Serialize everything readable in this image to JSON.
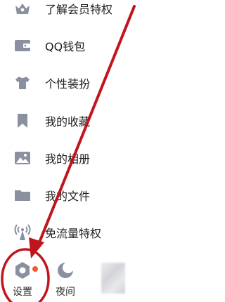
{
  "menu": {
    "items": [
      {
        "label": "了解会员特权",
        "icon": "crown-icon"
      },
      {
        "label": "QQ钱包",
        "icon": "wallet-icon"
      },
      {
        "label": "个性装扮",
        "icon": "tshirt-icon"
      },
      {
        "label": "我的收藏",
        "icon": "bookmark-icon"
      },
      {
        "label": "我的相册",
        "icon": "photo-icon"
      },
      {
        "label": "我的文件",
        "icon": "folder-icon"
      },
      {
        "label": "免流量特权",
        "icon": "signal-tower-icon"
      }
    ]
  },
  "bottom": {
    "settings_label": "设置",
    "night_label": "夜间"
  },
  "colors": {
    "icon": "#8a90a0",
    "annotation": "#c0151c",
    "badge": "#f25a2e"
  }
}
